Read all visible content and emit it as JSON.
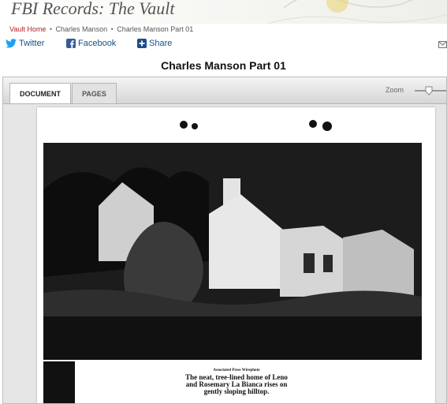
{
  "header": {
    "site_title": "FBI Records: The Vault"
  },
  "breadcrumb": {
    "home": "Vault Home",
    "category": "Charles Manson",
    "current": "Charles Manson Part 01",
    "separator": "•"
  },
  "social": {
    "twitter": "Twitter",
    "facebook": "Facebook",
    "share": "Share"
  },
  "document": {
    "title": "Charles Manson Part 01"
  },
  "viewer": {
    "tabs": [
      {
        "label": "DOCUMENT",
        "active": true
      },
      {
        "label": "PAGES",
        "active": false
      }
    ],
    "zoom_label": "Zoom"
  },
  "scan": {
    "credit": "Associated Press Wirephoto",
    "caption": "The neat, tree-lined home of Leno and Rosemary La Bianca rises on gently sloping hilltop."
  },
  "colors": {
    "link_red": "#b22222",
    "social_blue": "#1a4e8a",
    "twitter_blue": "#1da1f2"
  }
}
